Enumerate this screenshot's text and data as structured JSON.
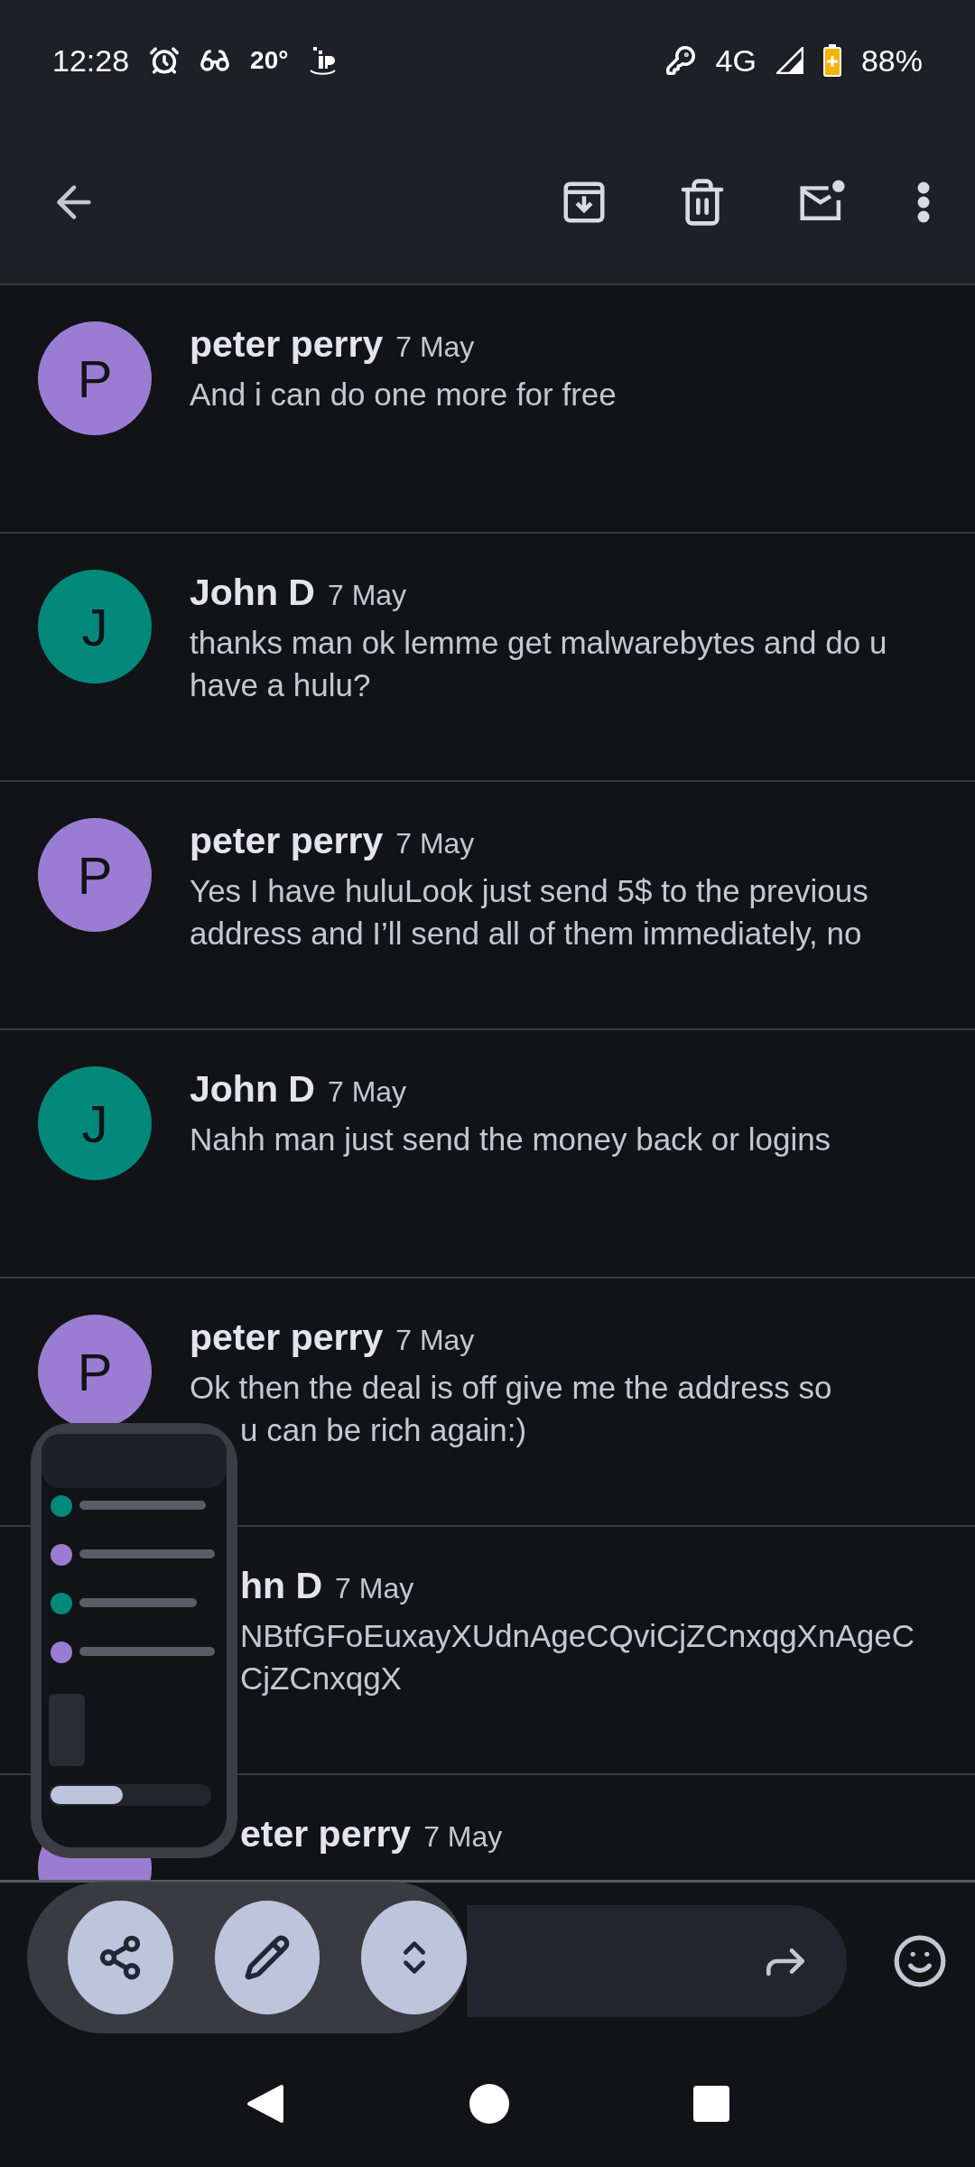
{
  "status_bar": {
    "time": "12:28",
    "temperature": "20°",
    "network": "4G",
    "battery": "88%"
  },
  "messages": [
    {
      "sender": "peter perry",
      "date": "7 May",
      "avatar": {
        "letter": "P",
        "color": "#9a7dd2"
      },
      "lines": [
        "And i can do one more for free"
      ]
    },
    {
      "sender": "John D",
      "date": "7 May",
      "avatar": {
        "letter": "J",
        "color": "#00897b"
      },
      "lines": [
        "thanks man ok lemme get malwarebytes and do u",
        "have a hulu?"
      ]
    },
    {
      "sender": "peter perry",
      "date": "7 May",
      "avatar": {
        "letter": "P",
        "color": "#9a7dd2"
      },
      "lines": [
        "Yes I have huluLook just send 5$ to the previous",
        "address and I’ll send all of them immediately, no"
      ]
    },
    {
      "sender": "John D",
      "date": "7 May",
      "avatar": {
        "letter": "J",
        "color": "#00897b"
      },
      "lines": [
        "Nahh man just send the money back or logins"
      ]
    },
    {
      "sender": "peter perry",
      "date": "7 May",
      "avatar": {
        "letter": "P",
        "color": "#9a7dd2"
      },
      "lines": [
        "Ok then the deal is off give me the address so",
        "u can be rich again:)"
      ]
    },
    {
      "sender": "hn D",
      "date": "7 May",
      "lines": [
        "NBtfGFoEuxayXUdnAgeCQviCjZCnxqgXnAgeC",
        "CjZCnxqgX"
      ]
    },
    {
      "sender": "eter perry",
      "date": "7 May",
      "avatar": {
        "color": "#9a7dd2"
      }
    }
  ]
}
